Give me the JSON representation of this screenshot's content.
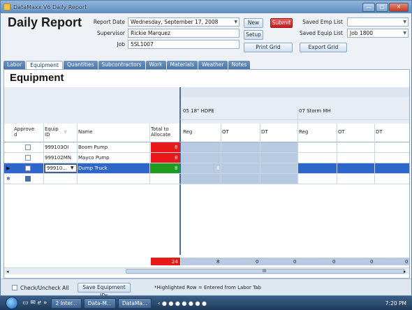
{
  "window": {
    "title": "DataMaxx V6 Daily Report",
    "min": "—",
    "max": "□",
    "close": "✕"
  },
  "header": {
    "title": "Daily Report",
    "report_date_label": "Report Date",
    "report_date_value": "Wednesday, September 17, 2008",
    "supervisor_label": "Supervisor",
    "supervisor_value": "Rickie Marquez",
    "job_label": "Job",
    "job_value": "5SL1007",
    "new_label": "New",
    "submit_label": "Submit",
    "setup_label": "Setup",
    "print_grid_label": "Print Grid",
    "saved_emp_label": "Saved Emp List",
    "saved_emp_value": "",
    "saved_equip_label": "Saved Equip List",
    "saved_equip_value": "Job 1800",
    "export_grid_label": "Export Grid"
  },
  "tabs": [
    "Labor",
    "Equipment",
    "Quantities",
    "Subcontractors",
    "Work",
    "Materials",
    "Weather",
    "Notes"
  ],
  "active_tab": "Equipment",
  "section_title": "Equipment",
  "grid": {
    "band_groups": [
      "05 18\" HDPE",
      "07 Storm MH"
    ],
    "columns": [
      "Approve d",
      "Equip ID",
      "Name",
      "Total to Allocate",
      "Reg",
      "OT",
      "DT",
      "Reg",
      "OT",
      "DT"
    ],
    "rows": [
      {
        "equip_id": "999103OI",
        "name": "Boom Pump",
        "total": "8",
        "reg1": "",
        "status": "red"
      },
      {
        "equip_id": "999102MN",
        "name": "Mayco Pump",
        "total": "8",
        "reg1": "",
        "status": "red"
      },
      {
        "equip_id": "99910...",
        "name": "Dump Truck",
        "total": "8",
        "reg1": "8",
        "status": "green"
      }
    ],
    "totals": [
      "24",
      "8",
      "0",
      "0",
      "0",
      "0",
      "0"
    ],
    "scroll_mark": "III"
  },
  "footer": {
    "check_all_label": "Check/Uncheck All",
    "save_label": "Save Equipment IDs",
    "note": "*Highlighted Row = Entered from Labor Tab"
  },
  "taskbar": {
    "items": [
      "2 Inter...",
      "Data-M...",
      "DataMa..."
    ],
    "clock": "7:20 PM"
  },
  "colors": {
    "red": "#e81818",
    "green": "#1f9b1f",
    "selected": "#2f66c9",
    "band": "#b8c9e2"
  }
}
